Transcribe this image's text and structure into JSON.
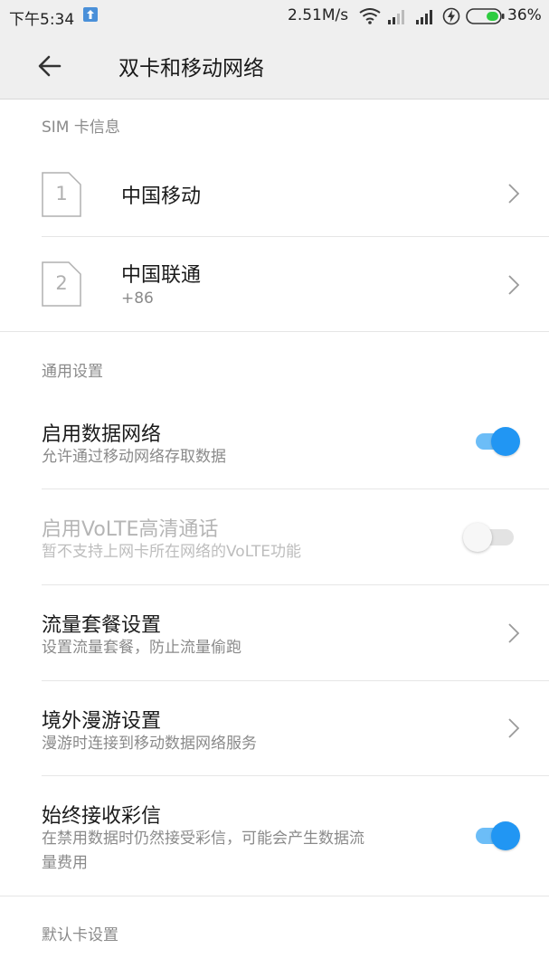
{
  "status_bar": {
    "time": "下午5:34",
    "upload_icon": "upload-arrow-icon",
    "speed": "2.51M/s",
    "battery_percent": "36%",
    "battery_level": 0.36,
    "battery_color": "#2ecc40"
  },
  "toolbar": {
    "back_icon": "back-arrow-icon",
    "title": "双卡和移动网络"
  },
  "sections": {
    "sim_info": "SIM 卡信息",
    "general": "通用设置",
    "default_card": "默认卡设置"
  },
  "sims": [
    {
      "slot": "1",
      "carrier": "中国移动"
    },
    {
      "slot": "2",
      "carrier": "中国联通",
      "number": "+86"
    }
  ],
  "settings": {
    "mobile_data": {
      "title": "启用数据网络",
      "subtitle": "允许通过移动网络存取数据",
      "enabled": true
    },
    "volte": {
      "title": "启用VoLTE高清通话",
      "subtitle": "暂不支持上网卡所在网络的VoLTE功能",
      "enabled": false,
      "disabled": true
    },
    "data_plan": {
      "title": "流量套餐设置",
      "subtitle": "设置流量套餐，防止流量偷跑"
    },
    "roaming": {
      "title": "境外漫游设置",
      "subtitle": "漫游时连接到移动数据网络服务"
    },
    "mms": {
      "title": "始终接收彩信",
      "subtitle": "在禁用数据时仍然接受彩信，可能会产生数据流量费用",
      "enabled": true
    }
  },
  "colors": {
    "accent": "#2196f3",
    "accent_light": "#6cbdf7",
    "secondary_text": "#8a8a8a"
  }
}
